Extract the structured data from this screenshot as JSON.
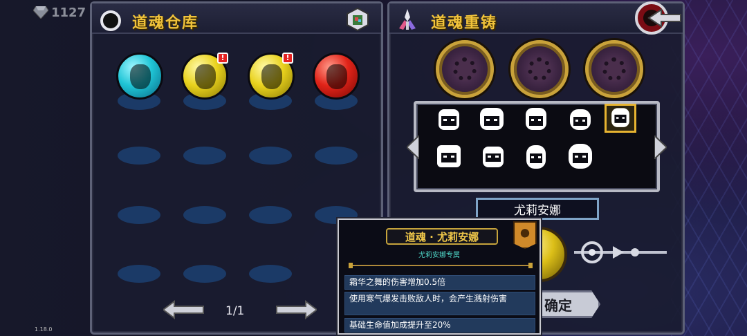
{
  "currency": {
    "amount": "1127",
    "icon": "gem-icon"
  },
  "version": "1.18.0",
  "warehouse": {
    "title": "道魂仓库",
    "icon": "ring-icon",
    "bag_icon": "bag-icon",
    "orbs": [
      {
        "color": "cyan",
        "alert": false
      },
      {
        "color": "yellow",
        "alert": true,
        "alert_text": "!"
      },
      {
        "color": "yellow",
        "alert": true,
        "alert_text": "!"
      },
      {
        "color": "red",
        "alert": false
      }
    ],
    "page": "1/1"
  },
  "reforge": {
    "title": "道魂重铸",
    "icon": "forge-icon",
    "back_icon": "back-arrow-icon",
    "sockets": 3,
    "portraits_row1": 5,
    "portraits_row2": 4,
    "selected_index": 4,
    "selected_name": "尤莉安娜",
    "confirm_label": "确定"
  },
  "tooltip": {
    "title": "道魂 · 尤莉安娜",
    "subtitle": "尤莉安娜专属",
    "effects": [
      "霜华之舞的伤害增加0.5倍",
      "使用寒气爆发击败敌人时，会产生溅射伤害",
      "基础生命值加成提升至20%"
    ]
  },
  "colors": {
    "title": "#f1c33b",
    "panel_border": "#5d6177",
    "slot": "#1b3c6a",
    "tooltip_line_bg": "#223a5c",
    "subtitle": "#4fd7c8"
  }
}
